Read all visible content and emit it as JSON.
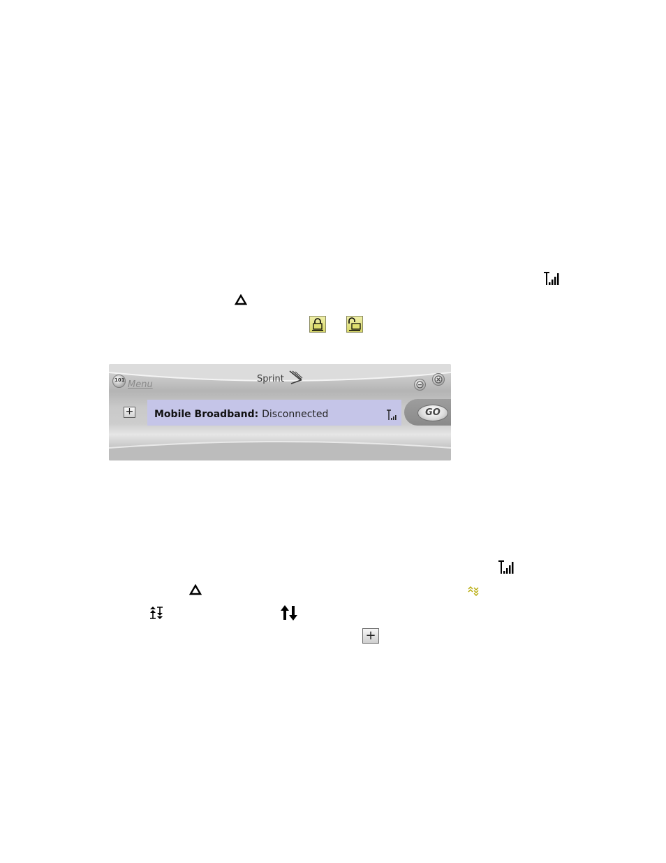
{
  "widget": {
    "menu_label": "Menu",
    "brand": "Sprint",
    "status_label": "Mobile Broadband:",
    "status_value": "Disconnected",
    "go_label": "GO",
    "expand_symbol": "+"
  },
  "icons": {
    "signal": "signal-strength-icon",
    "roaming": "roaming-triangle-icon",
    "locked": "locked-padlock-icon",
    "unlocked": "unlocked-padlock-icon",
    "dormant": "dormant-arrows-icon",
    "up_down": "up-down-arrows-icon",
    "data_activity": "data-activity-arrows-icon",
    "expand": "expand-plus-icon"
  },
  "colors": {
    "status_panel": "#c5c5e8",
    "lock_fill": "#dede78",
    "dormant_arrows": "#b4a800"
  },
  "floating_symbols": {
    "plus": "+"
  }
}
